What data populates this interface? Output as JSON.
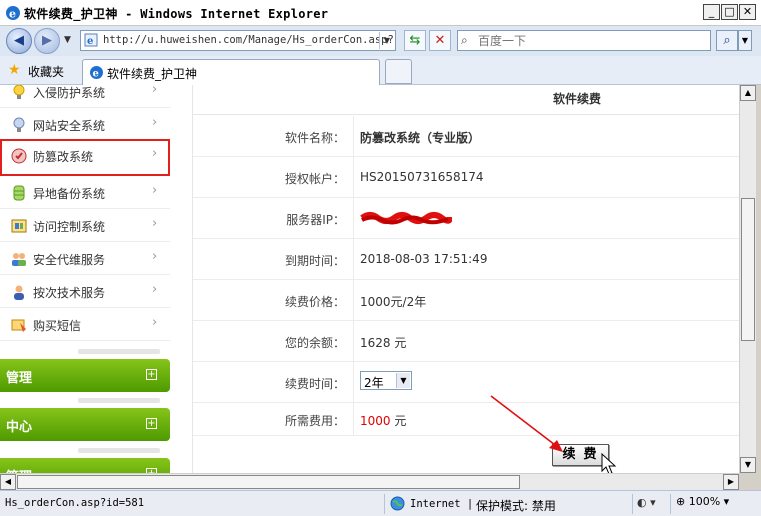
{
  "window": {
    "title": "软件续费_护卫神 - Windows Internet Explorer",
    "minimize": "_",
    "maximize": "□",
    "close": "✕"
  },
  "address_bar": {
    "url": "http://u.huweishen.com/Manage/Hs_orderCon.asp?",
    "search_placeholder": "百度一下"
  },
  "favorites": {
    "label": "收藏夹",
    "tab_title": "软件续费_护卫神"
  },
  "sidebar": {
    "items": [
      {
        "label": "入侵防护系统",
        "icon": "bulb-icon"
      },
      {
        "label": "网站安全系统",
        "icon": "bulb-icon"
      },
      {
        "label": "防篡改系统",
        "icon": "tamper-shield-icon",
        "highlighted": true
      },
      {
        "label": "异地备份系统",
        "icon": "database-icon"
      },
      {
        "label": "访问控制系统",
        "icon": "access-control-icon"
      },
      {
        "label": "安全代维服务",
        "icon": "people-icon"
      },
      {
        "label": "按次技术服务",
        "icon": "person-icon"
      },
      {
        "label": "购买短信",
        "icon": "sms-icon"
      }
    ],
    "sections": [
      "管理",
      "中心",
      "管理"
    ]
  },
  "main": {
    "header": "软件续费",
    "software_name_label": "软件名称：",
    "software_name": "防篡改系统（专业版）",
    "account_label": "授权帐户：",
    "account": "HS20150731658174",
    "server_ip_label": "服务器IP：",
    "expiry_label": "到期时间：",
    "expiry": "2018-08-03 17:51:49",
    "price_label": "续费价格：",
    "price": "1000元/2年",
    "balance_label": "您的余额：",
    "balance": "1628 元",
    "duration_label": "续费时间：",
    "duration_selected": "2年",
    "fee_label": "所需费用：",
    "fee_amount": "1000",
    "fee_unit": " 元",
    "renew_button": "续费"
  },
  "statusbar": {
    "link": "Hs_orderCon.asp?id=581",
    "zone": "Internet | ",
    "protected_mode": "保护模式: 禁用",
    "zoom": "100%"
  },
  "colors": {
    "highlight_border": "#e0201c",
    "sidebar_green": "#5aa40a",
    "fee_red": "#e00000"
  }
}
